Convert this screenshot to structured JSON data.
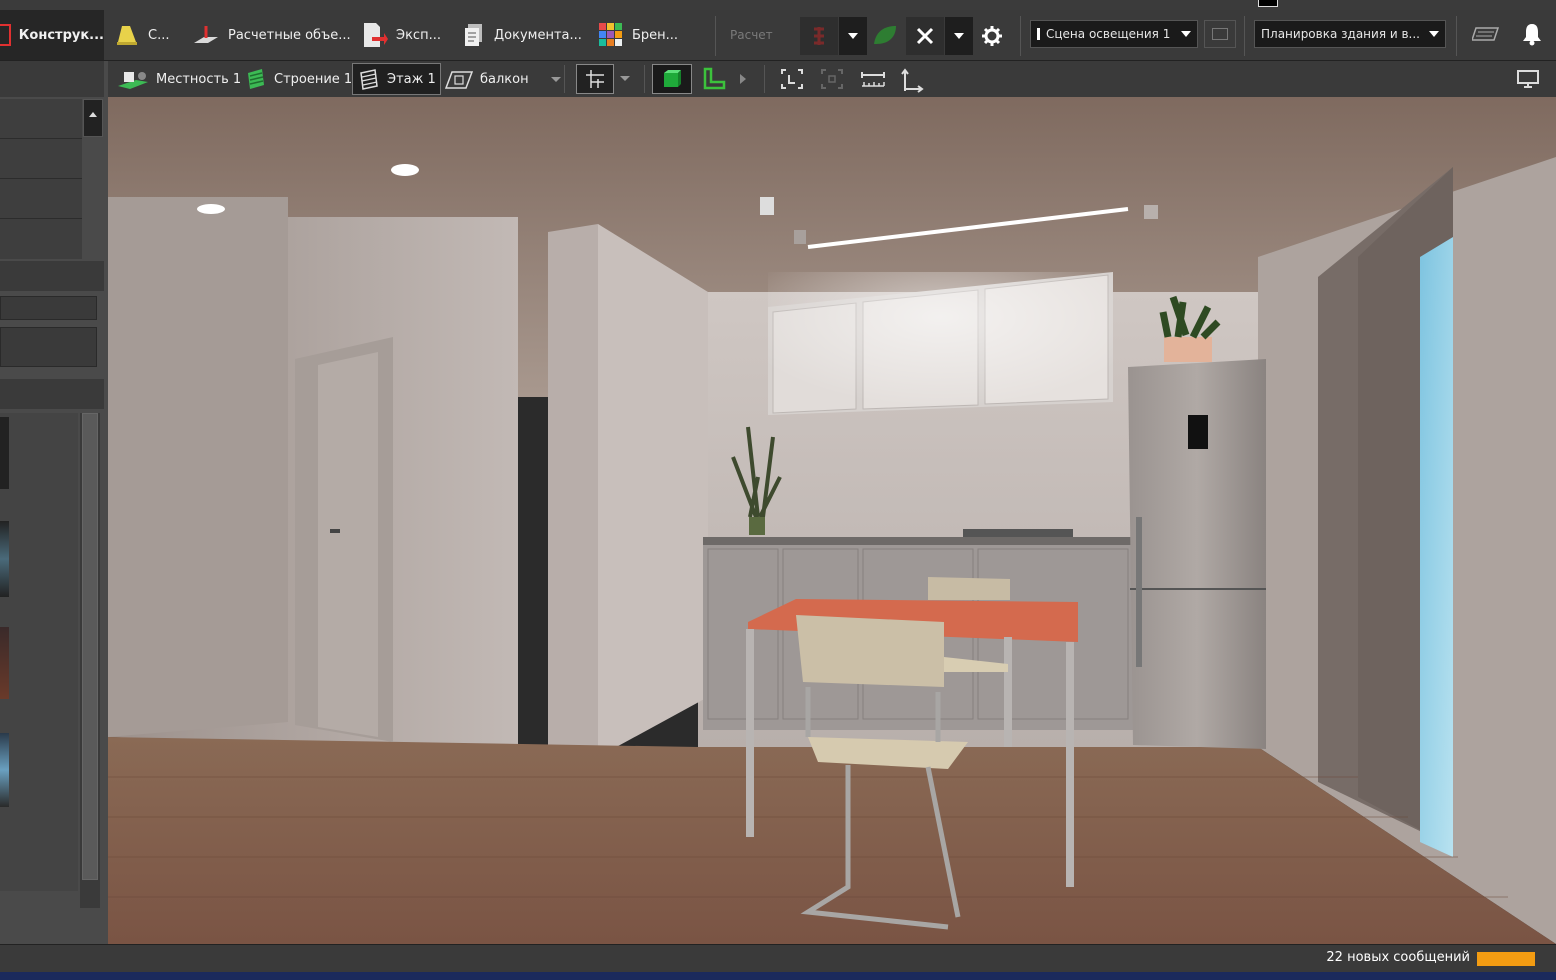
{
  "toolbar": {
    "construction_label": "Конструк...",
    "lighting_label": "С...",
    "calc_objects_label": "Расчетные объе...",
    "export_label": "Эксп...",
    "documentation_label": "Документа...",
    "branding_label": "Брен...",
    "calculate_label": "Расчет",
    "scene_select": "Сцена освещения 1",
    "layout_select": "Планировка здания и в..."
  },
  "breadcrumb": {
    "terrain": "Местность 1",
    "building": "Строение 1",
    "floor": "Этаж 1",
    "room": "балкон"
  },
  "status": {
    "messages": "22 новых сообщений"
  },
  "colors": {
    "background": "#2b2b2b",
    "toolbar": "#3a3a3a",
    "accent_green": "#3cc23c",
    "message_badge": "#f39c12",
    "bottom_bar": "#1b2a5c"
  }
}
